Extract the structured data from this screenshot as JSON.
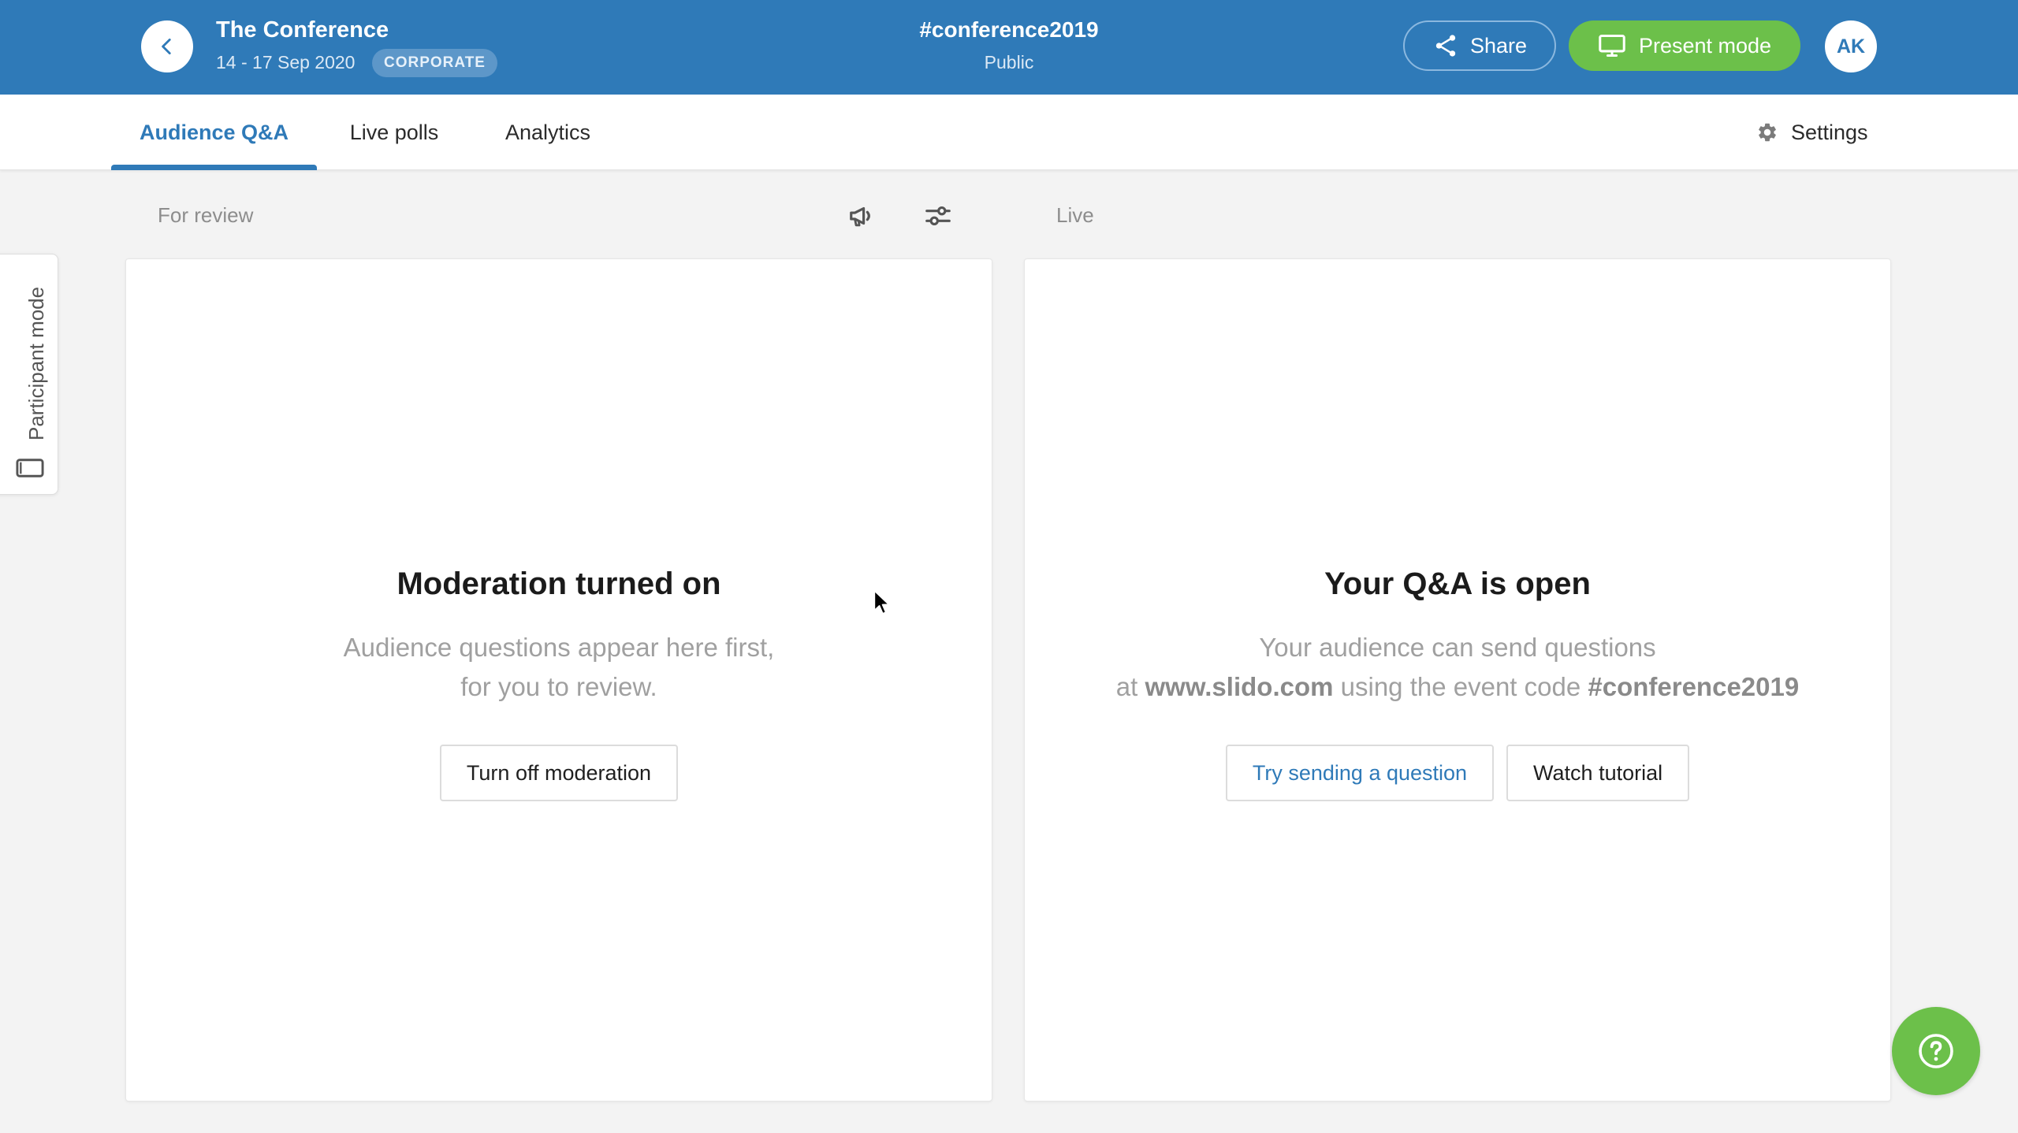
{
  "header": {
    "event_title": "The Conference",
    "event_dates": "14 - 17 Sep 2020",
    "badge": "CORPORATE",
    "event_code": "#conference2019",
    "visibility": "Public",
    "share_label": "Share",
    "present_label": "Present mode",
    "avatar_initials": "AK"
  },
  "tabs": [
    {
      "label": "Audience Q&A",
      "active": true
    },
    {
      "label": "Live polls",
      "active": false
    },
    {
      "label": "Analytics",
      "active": false
    }
  ],
  "settings_label": "Settings",
  "sidebar": {
    "participant_mode_label": "Participant mode"
  },
  "columns": {
    "review_label": "For review",
    "live_label": "Live"
  },
  "review_panel": {
    "title": "Moderation turned on",
    "desc_line1": "Audience questions appear here first,",
    "desc_line2": "for you to review.",
    "button_label": "Turn off moderation"
  },
  "live_panel": {
    "title": "Your Q&A is open",
    "desc_line1": "Your audience can send questions",
    "desc_at": "at",
    "desc_url": "www.slido.com",
    "desc_mid": "using the event code",
    "desc_code": "#conference2019",
    "try_button_label": "Try sending a question",
    "tutorial_button_label": "Watch tutorial"
  },
  "icons": {
    "back": "chevron-left-icon",
    "share": "share-icon",
    "present": "monitor-icon",
    "settings": "gear-icon",
    "announce": "megaphone-icon",
    "filter": "sliders-icon",
    "participant": "device-icon",
    "help": "question-icon"
  },
  "colors": {
    "brand_blue": "#2f7ab8",
    "present_green": "#6cc04a",
    "background": "#f3f3f3"
  }
}
